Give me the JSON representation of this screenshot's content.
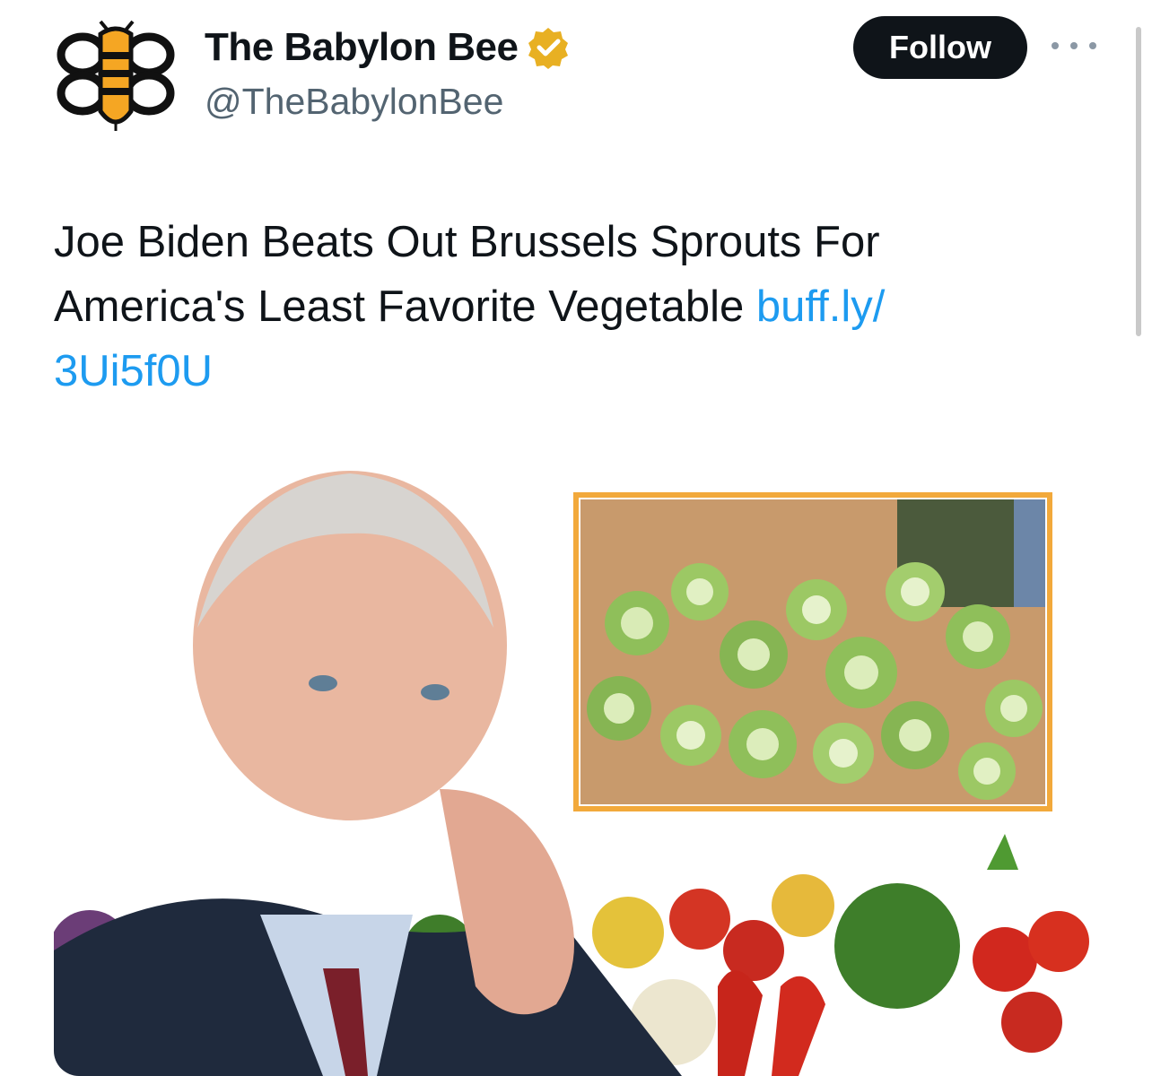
{
  "account": {
    "name": "The Babylon Bee",
    "handle": "@TheBabylonBee",
    "verified_icon": "gold-verified-badge-icon"
  },
  "follow_button": {
    "label": "Follow"
  },
  "more_button": {
    "icon": "more-horizontal-icon"
  },
  "tweet": {
    "text": "Joe Biden Beats Out Brussels Sprouts For America's Least Favorite Vegetable ",
    "link_line1": "buff.ly/",
    "link_line2": "3Ui5f0U"
  },
  "media": {
    "description_icon": "tweet-image",
    "frame_color": "#f2a93b"
  },
  "colors": {
    "text": "#0f1419",
    "secondary": "#536471",
    "link": "#1d9bf0",
    "badge": "#e8b023",
    "button": "#0f1419"
  }
}
